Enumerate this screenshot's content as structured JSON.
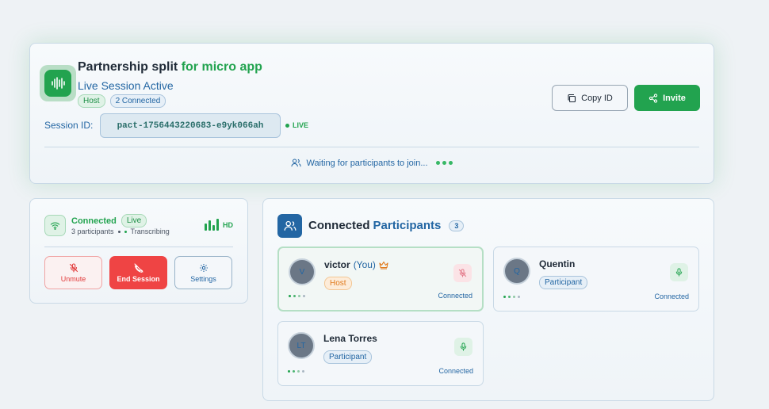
{
  "session": {
    "title_part1": "Partnership split",
    "title_part2": "for micro app",
    "status": "Live Session Active",
    "badge_host": "Host",
    "badge_connected": "2 Connected",
    "id_label": "Session ID:",
    "id_value": "pact-1756443220683-e9yk066ah",
    "live_label": "LIVE",
    "copy_label": "Copy ID",
    "invite_label": "Invite",
    "waiting_text": "Waiting for participants to join..."
  },
  "connection": {
    "status": "Connected",
    "live_badge": "Live",
    "participants_text": "3 participants",
    "transcribing_text": "Transcribing",
    "quality": "HD",
    "unmute_label": "Unmute",
    "end_label": "End Session",
    "settings_label": "Settings"
  },
  "participants_panel": {
    "title_part1": "Connected",
    "title_part2": "Participants",
    "count": "3",
    "participants": [
      {
        "initials": "V",
        "name": "victor",
        "you_label": "(You)",
        "role": "Host",
        "status": "Connected",
        "muted": true
      },
      {
        "initials": "Q",
        "name": "Quentin",
        "role": "Participant",
        "status": "Connected",
        "muted": false
      },
      {
        "initials": "LT",
        "name": "Lena Torres",
        "role": "Participant",
        "status": "Connected",
        "muted": false
      }
    ]
  },
  "colors": {
    "accent_green": "#22a34f",
    "accent_blue": "#2366a3",
    "danger_red": "#ef4444",
    "host_orange": "#e07a1c"
  },
  "icons": [
    "audio-wave-icon",
    "copy-icon",
    "share-icon",
    "users-icon",
    "wifi-icon",
    "signal-bars-icon",
    "mic-off-icon",
    "phone-off-icon",
    "gear-icon",
    "crown-icon",
    "mic-icon"
  ]
}
